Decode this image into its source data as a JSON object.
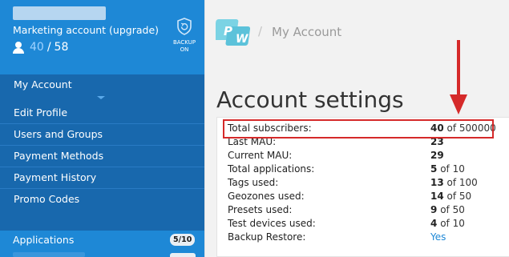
{
  "account": {
    "name": "Marketing account (upgrade)",
    "users_used": "40",
    "users_sep": "/",
    "users_total": "58",
    "backup_line1": "BACKUP",
    "backup_line2": "ON"
  },
  "sidebar": {
    "items": [
      {
        "label": "My Account"
      },
      {
        "label": "Edit Profile"
      },
      {
        "label": "Users and Groups"
      },
      {
        "label": "Payment Methods"
      },
      {
        "label": "Payment History"
      },
      {
        "label": "Promo Codes"
      }
    ],
    "applications": {
      "label": "Applications",
      "badge": "5/10"
    }
  },
  "breadcrumb": {
    "separator": "/",
    "current": "My Account"
  },
  "page": {
    "title": "Account settings"
  },
  "settings": [
    {
      "label": "Total subscribers:",
      "value": "40",
      "of": "of 500000"
    },
    {
      "label": "Last MAU:",
      "value": "23",
      "of": ""
    },
    {
      "label": "Current MAU:",
      "value": "29",
      "of": ""
    },
    {
      "label": "Total applications:",
      "value": "5",
      "of": "of 10"
    },
    {
      "label": "Tags used:",
      "value": "13",
      "of": "of 100"
    },
    {
      "label": "Geozones used:",
      "value": "14",
      "of": "of 50"
    },
    {
      "label": "Presets used:",
      "value": "9",
      "of": "of 50"
    },
    {
      "label": "Test devices used:",
      "value": "4",
      "of": "of 10"
    },
    {
      "label": "Backup Restore:",
      "value": "Yes",
      "of": ""
    }
  ],
  "colors": {
    "sidebar": "#1e88d6",
    "sidebar_menu": "#1868ad",
    "highlight": "#d52a2a",
    "link": "#1e88d6"
  },
  "icons": {
    "user": "user-icon",
    "backup": "shield-backup-icon",
    "logo": "pushwoosh-logo",
    "arrow": "red-down-arrow"
  }
}
